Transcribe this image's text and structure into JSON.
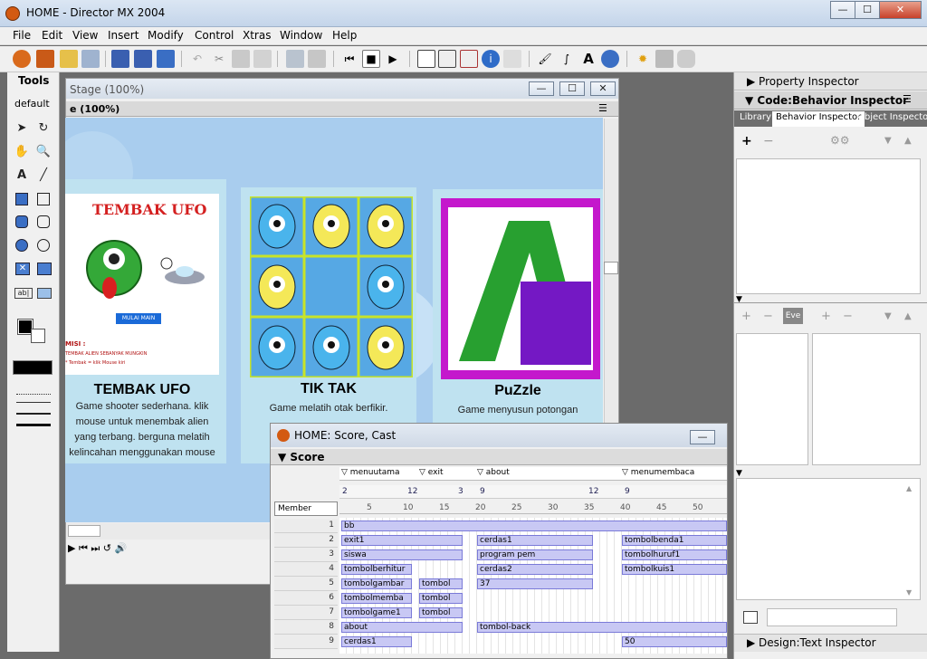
{
  "window": {
    "title": "HOME - Director MX 2004",
    "minimize": "—",
    "maximize": "☐",
    "close": "✕"
  },
  "menu": [
    "File",
    "Edit",
    "View",
    "Insert",
    "Modify",
    "Control",
    "Xtras",
    "Window",
    "Help"
  ],
  "tools": {
    "title": "Tools",
    "preset": "default"
  },
  "stage": {
    "window_title": "Stage (100%)",
    "header": "e (100%)"
  },
  "cards": [
    {
      "title": "TEMBAK UFO",
      "banner": "TEMBAK UFO",
      "button": "MULAI MAIN",
      "mission": "MISI :",
      "mission_text1": "TEMBAK ALIEN SEBANYAK MUNGKIN",
      "mission_text2": "* Tembak = klik Mouse kiri",
      "desc": [
        "Game shooter sederhana. klik",
        "mouse untuk menembak alien",
        "yang terbang. berguna melatih",
        "kelincahan menggunakan mouse"
      ]
    },
    {
      "title": "TIK TAK",
      "desc": [
        "Game melatih otak berfikir."
      ]
    },
    {
      "title": "PuZzle",
      "desc": [
        "Game menyusun potongan"
      ]
    }
  ],
  "score": {
    "window_title": "HOME: Score, Cast",
    "panel_title": "Score",
    "markers": [
      "menuutama",
      "exit",
      "about",
      "menumembaca"
    ],
    "tempo": [
      "2",
      "12",
      "3",
      "9",
      "12",
      "9"
    ],
    "member_label": "Member",
    "frame_numbers": [
      "5",
      "10",
      "15",
      "20",
      "25",
      "30",
      "35",
      "40",
      "45",
      "50"
    ],
    "channels": [
      "1",
      "2",
      "3",
      "4",
      "5",
      "6",
      "7",
      "8",
      "9"
    ],
    "sprites": [
      {
        "label": "bb"
      },
      {
        "label": "exit1"
      },
      {
        "label": "cerdas1"
      },
      {
        "label": "tombolbenda1"
      },
      {
        "label": "siswa"
      },
      {
        "label": "program pem"
      },
      {
        "label": "tombolhuruf1"
      },
      {
        "label": "tombolberhitur"
      },
      {
        "label": "cerdas2"
      },
      {
        "label": "tombolkuis1"
      },
      {
        "label": "tombolgambar"
      },
      {
        "label": "tombol"
      },
      {
        "label": "37"
      },
      {
        "label": "tombolmemba"
      },
      {
        "label": "tombol"
      },
      {
        "label": "tombolgame1"
      },
      {
        "label": "tombol"
      },
      {
        "label": "about"
      },
      {
        "label": "tombol-back"
      },
      {
        "label": "cerdas1"
      },
      {
        "label": "50"
      }
    ]
  },
  "right": {
    "property_inspector": "Property Inspector",
    "behavior_header": "Code:Behavior Inspector",
    "tabs": [
      "Library",
      "Behavior Inspector",
      "Object Inspecto"
    ],
    "eve": "Eve",
    "text_inspector": "Design:Text Inspector"
  }
}
